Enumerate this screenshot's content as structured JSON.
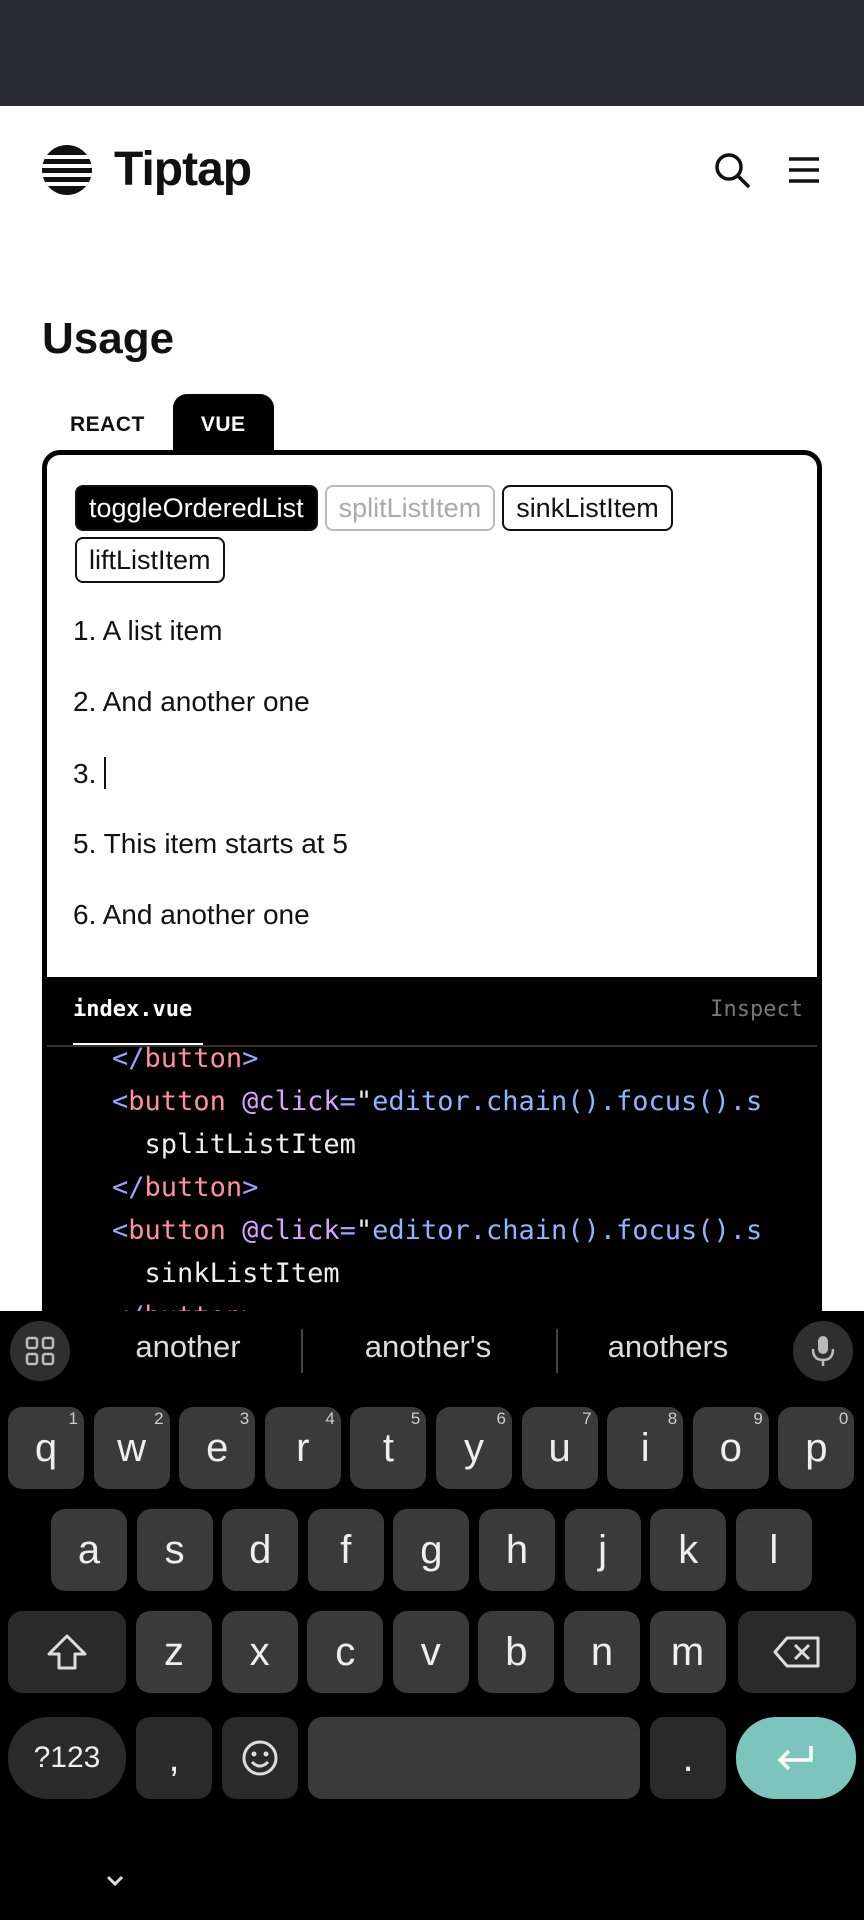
{
  "header": {
    "logo_text": "Tiptap"
  },
  "usage": {
    "title": "Usage",
    "tabs": [
      {
        "label": "REACT"
      },
      {
        "label": "VUE"
      }
    ]
  },
  "demo": {
    "buttons": [
      {
        "label": "toggleOrderedList"
      },
      {
        "label": "splitListItem"
      },
      {
        "label": "sinkListItem"
      },
      {
        "label": "liftListItem"
      }
    ],
    "list_items": [
      {
        "number": "1.",
        "text": "A list item"
      },
      {
        "number": "2.",
        "text": "And another one"
      },
      {
        "number": "3.",
        "text": ""
      },
      {
        "number": "5.",
        "text": "This item starts at 5"
      },
      {
        "number": "6.",
        "text": "And another one"
      }
    ]
  },
  "code_panel": {
    "file_name": "index.vue",
    "inspect_label": "Inspect",
    "lines": [
      {
        "indent": "    ",
        "open": "</",
        "tag": "button",
        "close": ">",
        "attr": "",
        "eq": "",
        "quote": "",
        "rest": "",
        "text": ""
      },
      {
        "indent": "    ",
        "open": "<",
        "tag": "button",
        "close": "",
        "attr": " @click",
        "eq": "=",
        "quote": "\"",
        "rest": "editor.chain().focus().s",
        "text": ""
      },
      {
        "indent": "      ",
        "open": "",
        "tag": "",
        "close": "",
        "attr": "",
        "eq": "",
        "quote": "",
        "rest": "",
        "text": "splitListItem"
      },
      {
        "indent": "    ",
        "open": "</",
        "tag": "button",
        "close": ">",
        "attr": "",
        "eq": "",
        "quote": "",
        "rest": "",
        "text": ""
      },
      {
        "indent": "    ",
        "open": "<",
        "tag": "button",
        "close": "",
        "attr": " @click",
        "eq": "=",
        "quote": "\"",
        "rest": "editor.chain().focus().s",
        "text": ""
      },
      {
        "indent": "      ",
        "open": "",
        "tag": "",
        "close": "",
        "attr": "",
        "eq": "",
        "quote": "",
        "rest": "",
        "text": "sinkListItem"
      },
      {
        "indent": "    ",
        "open": "</",
        "tag": "button",
        "close": ">",
        "attr": "",
        "eq": "",
        "quote": "",
        "rest": "",
        "text": ""
      }
    ]
  },
  "keyboard": {
    "suggestions": [
      "another",
      "another's",
      "anothers"
    ],
    "row1": [
      {
        "key": "q",
        "hint": "1"
      },
      {
        "key": "w",
        "hint": "2"
      },
      {
        "key": "e",
        "hint": "3"
      },
      {
        "key": "r",
        "hint": "4"
      },
      {
        "key": "t",
        "hint": "5"
      },
      {
        "key": "y",
        "hint": "6"
      },
      {
        "key": "u",
        "hint": "7"
      },
      {
        "key": "i",
        "hint": "8"
      },
      {
        "key": "o",
        "hint": "9"
      },
      {
        "key": "p",
        "hint": "0"
      }
    ],
    "row2": [
      "a",
      "s",
      "d",
      "f",
      "g",
      "h",
      "j",
      "k",
      "l"
    ],
    "row3": [
      "z",
      "x",
      "c",
      "v",
      "b",
      "n",
      "m"
    ],
    "symbols_label": "?123",
    "comma": ",",
    "period": "."
  }
}
